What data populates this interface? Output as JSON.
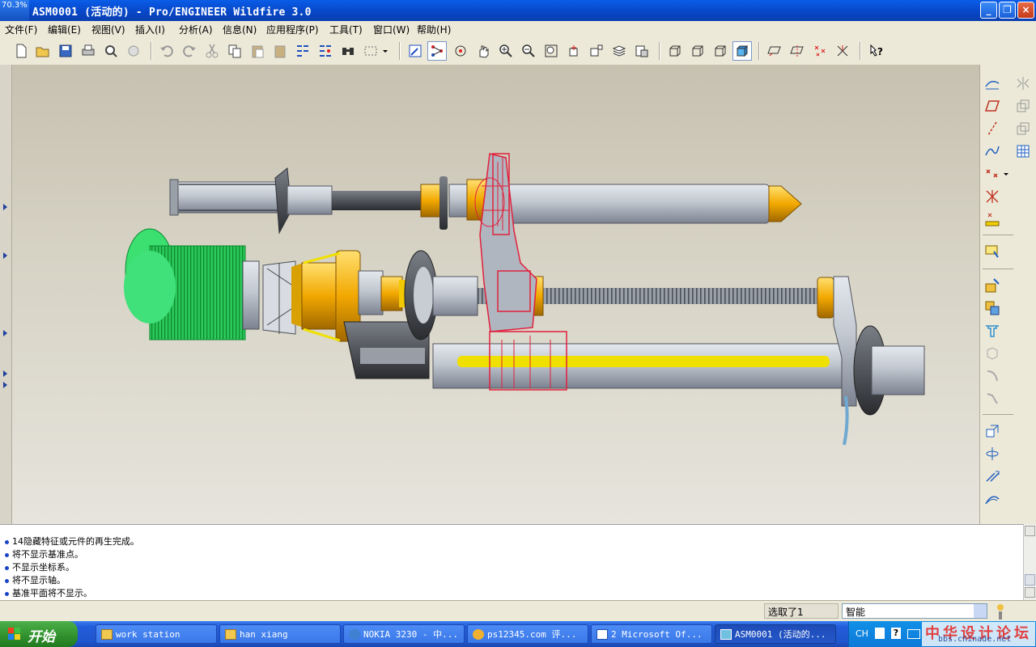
{
  "window": {
    "app_icon_text": "70.3%",
    "title": "ASM0001 (活动的) - Pro/ENGINEER Wildfire 3.0",
    "minimize_label": "_",
    "maximize_label": "❐",
    "close_label": "×"
  },
  "menu": [
    {
      "label": "文件(F)"
    },
    {
      "label": "编辑(E)"
    },
    {
      "label": "视图(V)"
    },
    {
      "label": "插入(I)"
    },
    {
      "label": "分析(A)"
    },
    {
      "label": "信息(N)"
    },
    {
      "label": "应用程序(P)"
    },
    {
      "label": "工具(T)"
    },
    {
      "label": "窗口(W)"
    },
    {
      "label": "帮助(H)"
    }
  ],
  "toolbar_icons": [
    "new-icon",
    "open-icon",
    "save-icon",
    "print-icon",
    "print-preview-icon",
    "print-setup-icon",
    "undo-icon",
    "redo-icon",
    "cut-icon",
    "copy-icon",
    "paste-icon",
    "paste-special-icon",
    "regenerate-icon",
    "regenerate-manager-icon",
    "find-icon",
    "select-box-icon",
    "repaint-icon",
    "spin-center-icon",
    "orient-mode-icon",
    "pan-icon",
    "zoom-in-icon",
    "zoom-out-icon",
    "refit-icon",
    "reorient-icon",
    "saved-views-icon",
    "layers-icon",
    "view-manager-icon",
    "wireframe-icon",
    "hidden-line-icon",
    "no-hidden-icon",
    "shading-icon",
    "datum-plane-display-icon",
    "datum-axis-display-icon",
    "datum-point-display-icon",
    "csys-display-icon",
    "context-help-icon"
  ],
  "messages": [
    "14隐藏特征或元件的再生完成。",
    "将不显示基准点。",
    "不显示坐标系。",
    "将不显示轴。",
    "基准平面将不显示。"
  ],
  "status": {
    "selection_text": "选取了1",
    "filter_value": "智能"
  },
  "taskbar": {
    "start_label": "开始",
    "tasks": [
      {
        "label": "work station",
        "icon": "folder-icon"
      },
      {
        "label": "han xiang",
        "icon": "folder-icon"
      },
      {
        "label": "NOKIA 3230 - 中...",
        "icon": "browser-icon"
      },
      {
        "label": "ps12345.com 评...",
        "icon": "chat-icon"
      },
      {
        "label": "2 Microsoft Of...",
        "icon": "word-icon"
      },
      {
        "label": "ASM0001 (活动的...",
        "icon": "proe-icon"
      }
    ],
    "tray_lang": "CH",
    "watermark": "中华设计论坛",
    "watermark_url": "bbs.chinade.net"
  },
  "colors": {
    "title_bar": "#0a4fd8",
    "part_gray": "#b8bec6",
    "part_orange": "#f0a800",
    "motor_green": "#30d060",
    "highlight_red": "#e0203c",
    "rail_yellow": "#f0e000"
  }
}
